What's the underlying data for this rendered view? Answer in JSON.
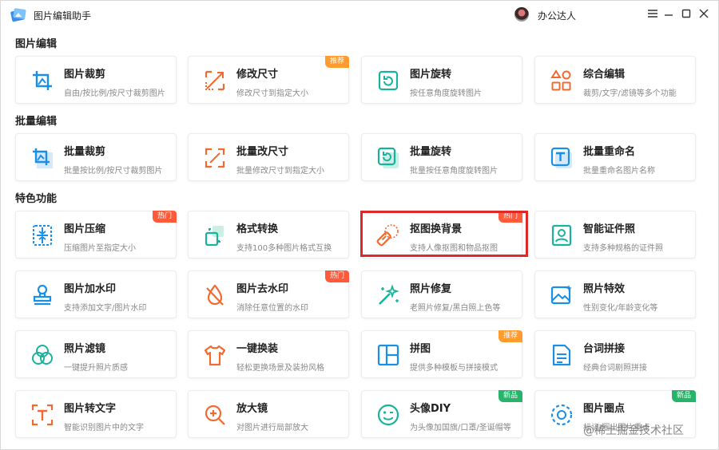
{
  "window": {
    "title": "图片编辑助手",
    "user_name": "办公达人"
  },
  "colors": {
    "accent_blue": "#1a8fe8",
    "accent_orange": "#f26a30",
    "accent_teal": "#19b39b",
    "badge_recommend": "#ff9b2f",
    "badge_hot": "#ff5a3a",
    "badge_new": "#27b36a",
    "highlight_red": "#e02828"
  },
  "sections": [
    {
      "title": "图片编辑",
      "cards": [
        {
          "title": "图片裁剪",
          "desc": "自由/按比例/按尺寸裁剪图片",
          "icon": "crop-icon",
          "badge": ""
        },
        {
          "title": "修改尺寸",
          "desc": "修改尺寸到指定大小",
          "icon": "resize-icon",
          "badge": "推荐"
        },
        {
          "title": "图片旋转",
          "desc": "按任意角度旋转图片",
          "icon": "rotate-icon",
          "badge": ""
        },
        {
          "title": "综合编辑",
          "desc": "裁剪/文字/滤镜等多个功能",
          "icon": "shapes-icon",
          "badge": ""
        }
      ]
    },
    {
      "title": "批量编辑",
      "cards": [
        {
          "title": "批量裁剪",
          "desc": "批量按比例/按尺寸裁剪图片",
          "icon": "batch-crop-icon",
          "badge": ""
        },
        {
          "title": "批量改尺寸",
          "desc": "批量修改尺寸到指定大小",
          "icon": "batch-resize-icon",
          "badge": ""
        },
        {
          "title": "批量旋转",
          "desc": "批量按任意角度旋转图片",
          "icon": "batch-rotate-icon",
          "badge": ""
        },
        {
          "title": "批量重命名",
          "desc": "批量重命名图片名称",
          "icon": "rename-icon",
          "badge": ""
        }
      ]
    },
    {
      "title": "特色功能",
      "cards": [
        {
          "title": "图片压缩",
          "desc": "压缩图片至指定大小",
          "icon": "compress-icon",
          "badge": "热门"
        },
        {
          "title": "格式转换",
          "desc": "支持100多种图片格式互换",
          "icon": "format-convert-icon",
          "badge": ""
        },
        {
          "title": "抠图换背景",
          "desc": "支持人像抠图和物品抠图",
          "icon": "eraser-icon",
          "badge": "热门"
        },
        {
          "title": "智能证件照",
          "desc": "支持多种规格的证件照",
          "icon": "id-photo-icon",
          "badge": ""
        },
        {
          "title": "图片加水印",
          "desc": "支持添加文字/图片水印",
          "icon": "stamp-icon",
          "badge": ""
        },
        {
          "title": "图片去水印",
          "desc": "消除任意位置的水印",
          "icon": "remove-watermark-icon",
          "badge": "热门"
        },
        {
          "title": "照片修复",
          "desc": "老照片修复/黑白照上色等",
          "icon": "magic-wand-icon",
          "badge": ""
        },
        {
          "title": "照片特效",
          "desc": "性别变化/年龄变化等",
          "icon": "image-effect-icon",
          "badge": ""
        },
        {
          "title": "照片滤镜",
          "desc": "一键提升照片质感",
          "icon": "filter-icon",
          "badge": ""
        },
        {
          "title": "一键换装",
          "desc": "轻松更换场景及装扮风格",
          "icon": "tshirt-icon",
          "badge": ""
        },
        {
          "title": "拼图",
          "desc": "提供多种模板与拼接模式",
          "icon": "collage-icon",
          "badge": "推荐"
        },
        {
          "title": "台词拼接",
          "desc": "经典台词剧照拼接",
          "icon": "subtitle-icon",
          "badge": ""
        },
        {
          "title": "图片转文字",
          "desc": "智能识别图片中的文字",
          "icon": "ocr-icon",
          "badge": ""
        },
        {
          "title": "放大镜",
          "desc": "对图片进行局部放大",
          "icon": "magnifier-icon",
          "badge": ""
        },
        {
          "title": "头像DIY",
          "desc": "为头像加国旗/口罩/圣诞帽等",
          "icon": "smile-icon",
          "badge": "新品"
        },
        {
          "title": "图片圈点",
          "desc": "标记/圈出图片重点",
          "icon": "circle-mark-icon",
          "badge": "新品"
        }
      ]
    }
  ],
  "watermark": "@稀土掘金技术社区"
}
